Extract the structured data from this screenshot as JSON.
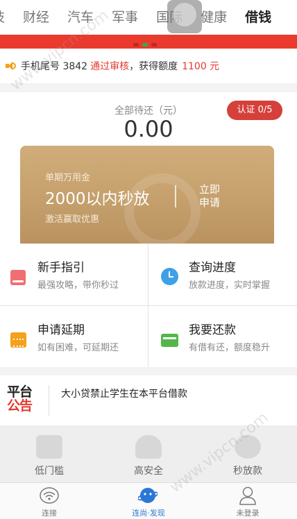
{
  "category_tabs": [
    {
      "label": "技",
      "active": false
    },
    {
      "label": "财经",
      "active": false
    },
    {
      "label": "汽车",
      "active": false
    },
    {
      "label": "军事",
      "active": false
    },
    {
      "label": "国际",
      "active": false
    },
    {
      "label": "健康",
      "active": false
    },
    {
      "label": "借钱",
      "active": true
    }
  ],
  "notice": {
    "prefix": "手机尾号 3842",
    "status": "通过审核",
    "middle": "，获得额度",
    "amount": "1100 元"
  },
  "account": {
    "total_label": "全部待还（元）",
    "total_value": "0.00",
    "verify_label": "认证 0/5"
  },
  "loan_card": {
    "subtitle": "单期万用金",
    "headline": "2000以内秒放",
    "hint": "激活赢取优惠",
    "apply_label": "立即申请"
  },
  "quick_actions": [
    {
      "title": "新手指引",
      "desc": "最强攻略，带你秒过",
      "icon": "guide-book-icon"
    },
    {
      "title": "查询进度",
      "desc": "放款进度，实时掌握",
      "icon": "alarm-clock-icon"
    },
    {
      "title": "申请延期",
      "desc": "如有困难，可延期还",
      "icon": "calendar-icon"
    },
    {
      "title": "我要还款",
      "desc": "有借有还，额度稳升",
      "icon": "card-icon"
    }
  ],
  "announcement": {
    "logo_line1": "平台",
    "logo_line2": "公告",
    "text": "大小贷禁止学生在本平台借款"
  },
  "features": [
    {
      "label": "低门槛",
      "icon": "sofa-icon"
    },
    {
      "label": "高安全",
      "icon": "shield-user-icon"
    },
    {
      "label": "秒放款",
      "icon": "piggy-bank-icon"
    }
  ],
  "bottom_nav": [
    {
      "label": "连接",
      "icon": "wifi-icon",
      "active": false
    },
    {
      "label": "连尚·发现",
      "icon": "planet-icon",
      "active": true
    },
    {
      "label": "未登录",
      "icon": "person-icon",
      "active": false
    }
  ],
  "colors": {
    "brand_red": "#ea3a2e",
    "gold": "#c8a26e",
    "link_blue": "#2a78d6"
  },
  "watermark": "www.vipcn.com"
}
